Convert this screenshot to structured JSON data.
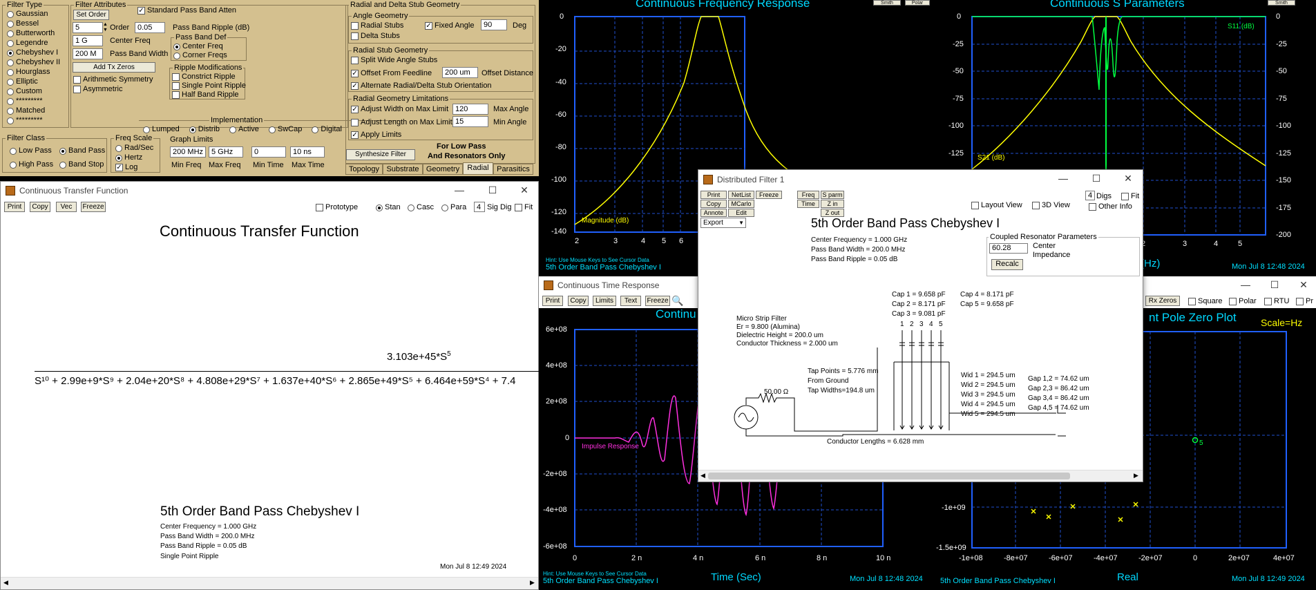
{
  "filter_type": {
    "title": "Filter Type",
    "items": [
      {
        "label": "Gaussian",
        "on": false
      },
      {
        "label": "Bessel",
        "on": false
      },
      {
        "label": "Butterworth",
        "on": false
      },
      {
        "label": "Legendre",
        "on": false
      },
      {
        "label": "Chebyshev I",
        "on": true
      },
      {
        "label": "Chebyshev II",
        "on": false
      },
      {
        "label": "Hourglass",
        "on": false
      },
      {
        "label": "Elliptic",
        "on": false
      },
      {
        "label": "Custom",
        "on": false
      },
      {
        "label": "*********",
        "on": false
      },
      {
        "label": "Matched",
        "on": false
      },
      {
        "label": "*********",
        "on": false
      }
    ]
  },
  "filter_attr": {
    "title": "Filter Attributes",
    "set_order": "Set Order",
    "order_value": "5",
    "order_label": "Order",
    "ripple_value": "0.05",
    "ripple_label": "Pass Band Ripple (dB)",
    "std_atten": "Standard Pass Band Atten",
    "center_value": "1 G",
    "center_label": "Center Freq",
    "pbw_value": "200 M",
    "pbw_label": "Pass Band Width",
    "add_tx_zeros": "Add Tx Zeros",
    "arith_sym": "Arithmetic Symmetry",
    "asym": "Asymmetric",
    "pb_def_title": "Pass Band  Def",
    "pb_def_center": "Center Freq",
    "pb_def_corner": "Corner Freqs",
    "ripple_mod_title": "Ripple Modifications",
    "rm_constrict": "Constrict Ripple",
    "rm_single": "Single Point Ripple",
    "rm_half": "Half Band Ripple",
    "impl_title": "Implementation",
    "impl": [
      "Lumped",
      "Distrib",
      "Active",
      "SwCap",
      "Digital"
    ]
  },
  "radial": {
    "title": "Radial and Delta Stub Geometry",
    "angle_title": "Angle Geometry",
    "radial_stubs": "Radial Stubs",
    "fixed_angle": "Fixed Angle",
    "angle_value": "90",
    "deg": "Deg",
    "delta_stubs": "Delta Stubs",
    "stub_title": "Radial Stub Geometry",
    "split": "Split Wide Angle Stubs",
    "offset": "Offset From Feedline",
    "offset_value": "200 um",
    "offset_dist": "Offset Distance",
    "alternate": "Alternate Radial/Delta Stub Orientation",
    "limit_title": "Radial Geometry Limitations",
    "adj_width": "Adjust Width on Max Limit",
    "max_angle_value": "120",
    "max_angle": "Max Angle",
    "adj_len": "Adjust Length on Max Limit",
    "min_angle_value": "15",
    "min_angle": "Min Angle",
    "apply": "Apply Limits",
    "synthesize": "Synthesize Filter",
    "note1": "For Low Pass",
    "note2": "And Resonators Only",
    "tabs": [
      "Topology",
      "Substrate",
      "Geometry",
      "Radial",
      "Parasitics"
    ]
  },
  "filter_class": {
    "title": "Filter Class",
    "items": [
      "Low Pass",
      "Band Pass",
      "High Pass",
      "Band Stop"
    ]
  },
  "freq_scale": {
    "title": "Freq Scale",
    "items": [
      "Rad/Sec",
      "Hertz",
      "Log"
    ]
  },
  "graph_limits": {
    "title": "Graph Limits",
    "values": [
      "200 MHz",
      "5 GHz",
      "0",
      "10 ns"
    ],
    "labels": [
      "Min Freq",
      "Max Freq",
      "Min Time",
      "Max Time"
    ]
  },
  "ctf": {
    "window_title": "Continuous Transfer Function",
    "buttons": [
      "Print",
      "Copy",
      "Vec",
      "Freeze"
    ],
    "prototype": "Prototype",
    "modes": [
      "Stan",
      "Casc",
      "Para"
    ],
    "sig_value": "4",
    "sig_label": "Sig Dig",
    "fit": "Fit",
    "heading": "Continuous Transfer Function",
    "numerator": "3.103e+45*S",
    "num_exp": "5",
    "denominator": "S¹⁰ + 2.99e+9*S⁹ + 2.04e+20*S⁸ + 4.808e+29*S⁷ + 1.637e+40*S⁶ + 2.865e+49*S⁵ + 6.464e+59*S⁴ + 7.4",
    "subtitle": "5th Order Band Pass Chebyshev I",
    "info": [
      "Center Frequency = 1.000 GHz",
      "Pass Band Width = 200.0 MHz",
      "Pass Band Ripple = 0.05 dB",
      "Single Point Ripple"
    ],
    "date": "Mon Jul  8 12:49 2024"
  },
  "freq_plot": {
    "title": "Continuous Frequency Response",
    "yticks": [
      "0",
      "-20",
      "-40",
      "-60",
      "-80",
      "-100",
      "-120",
      "-140"
    ],
    "xticks": [
      "2",
      "3",
      "4",
      "5",
      "6"
    ],
    "series_label": "Magnitude (dB)",
    "hint": "Hint: Use Mouse Keys to See Cursor Data",
    "footer": "5th Order Band Pass Chebyshev I",
    "top_btns": [
      "Smith",
      "Polar"
    ]
  },
  "s_plot": {
    "title": "Continuous S Parameters",
    "yticks": [
      "0",
      "-25",
      "-50",
      "-75",
      "-100",
      "-125"
    ],
    "yticks_r": [
      "0",
      "-25",
      "-50",
      "-75",
      "-100",
      "-125",
      "-150",
      "-175",
      "-200"
    ],
    "xticks": [
      "2",
      "3",
      "4",
      "5"
    ],
    "s11": "S11 (dB)",
    "s21": "S21 (dB)",
    "xlabel": "(Hz)",
    "date": "Mon Jul  8 12:48 2024",
    "top_btns": [
      "Smith"
    ]
  },
  "time_plot": {
    "window_title": "Continuous Time Response",
    "buttons": [
      "Print",
      "Copy",
      "Limits",
      "Text",
      "Freeze"
    ],
    "title": "Continu",
    "yticks": [
      "6e+08",
      "4e+08",
      "2e+08",
      "0",
      "-2e+08",
      "-4e+08",
      "-6e+08"
    ],
    "xticks": [
      "0",
      "2 n",
      "4 n",
      "6 n",
      "8 n",
      "10 n"
    ],
    "series_label": "Impulse Response",
    "xlabel": "Time (Sec)",
    "hint": "Hint: Use Mouse Keys to See Cursor Data",
    "footer": "5th Order Band Pass Chebyshev I",
    "date": "Mon Jul  8 12:48 2024"
  },
  "pz_plot": {
    "toolbar": [
      "Rx Zeros",
      "Square",
      "Polar",
      "RTU",
      "Pr"
    ],
    "title": "nt Pole Zero Plot",
    "scale": "Scale=Hz",
    "yticks": [
      "-1e+09",
      "-1.5e+09"
    ],
    "xticks": [
      "-1e+08",
      "-8e+07",
      "-6e+07",
      "-4e+07",
      "-2e+07",
      "0",
      "2e+07",
      "4e+07"
    ],
    "xlabel": "Real",
    "zero_label": "5",
    "footer": "5th Order Band Pass Chebyshev I",
    "date": "Mon Jul  8 12:49 2024"
  },
  "dist": {
    "window_title": "Distributed Filter 1",
    "buttons": [
      "Print",
      "NetList",
      "Freeze",
      "Freq",
      "S parm",
      "Copy",
      "MCarlo",
      "Time",
      "Z in",
      "Annote",
      "Edit",
      "Z out"
    ],
    "export": "Export",
    "layout": "Layout View",
    "view3d": "3D View",
    "other": "Other Info",
    "digs_value": "4",
    "digs": "Digs",
    "fit": "Fit",
    "heading": "5th Order Band Pass Chebyshev I",
    "info": [
      "Center Frequency = 1.000 GHz",
      "Pass Band Width = 200.0 MHz",
      "Pass Band Ripple = 0.05 dB"
    ],
    "coupled_title": "Coupled Resonator Parameters",
    "coupled_value": "60.28",
    "coupled_center": "Center",
    "coupled_imp": "Impedance",
    "recalc": "Recalc",
    "caps1": [
      "Cap 1 = 9.658 pF",
      "Cap 2 = 8.171 pF",
      "Cap 3 = 9.081 pF"
    ],
    "caps2": [
      "Cap 4 = 8.171 pF",
      "Cap 5 = 9.658 pF"
    ],
    "res_nums": [
      "1",
      "2",
      "3",
      "4",
      "5"
    ],
    "micro": [
      "Micro Strip Filter",
      "Er = 9.800 (Alumina)",
      "Dielectric Height = 200.0 um",
      "Conductor Thickness = 2.000 um"
    ],
    "tap": [
      "Tap Points = 5.776 mm",
      "From Ground",
      "Tap Widths=194.8 um"
    ],
    "source_r": "50.00 Ω",
    "wids": [
      "Wid 1 = 294.5 um",
      "Wid 2 = 294.5 um",
      "Wid 3 = 294.5 um",
      "Wid 4 = 294.5 um",
      "Wid 5 = 294.5 um"
    ],
    "gaps": [
      "Gap 1,2 = 74.62 um",
      "Gap 2,3 = 86.42 um",
      "Gap 3,4 = 86.42 um",
      "Gap 4,5 = 74.62 um"
    ],
    "cond_len": "Conductor Lengths = 6.628 mm"
  }
}
